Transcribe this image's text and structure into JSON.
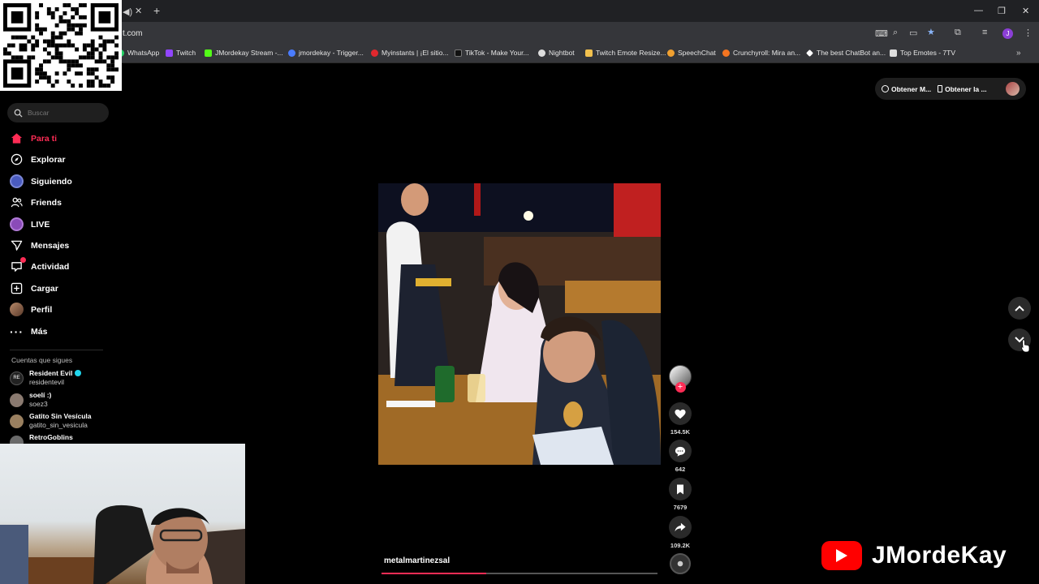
{
  "browser": {
    "url_fragment": "t.com",
    "bookmarks": [
      {
        "label": "WhatsApp",
        "color": "#25d366"
      },
      {
        "label": "Twitch",
        "color": "#9146ff"
      },
      {
        "label": "JMordekay Stream -...",
        "color": "#53fc18"
      },
      {
        "label": "jmordekay - Trigger...",
        "color": "#4a7cff"
      },
      {
        "label": "Myinstants | ¡El sitio...",
        "color": "#e0282e"
      },
      {
        "label": "TikTok - Make Your...",
        "color": "#111111"
      },
      {
        "label": "Nightbot",
        "color": "#dddddd"
      },
      {
        "label": "Twitch Emote Resize...",
        "color": "#f2c14e"
      },
      {
        "label": "SpeechChat",
        "color": "#f0a030"
      },
      {
        "label": "Crunchyroll: Mira an...",
        "color": "#f47521"
      },
      {
        "label": "The best ChatBot an...",
        "color": "#ffffff"
      },
      {
        "label": "Top Emotes - 7TV",
        "color": "#dddddd"
      }
    ]
  },
  "search": {
    "placeholder": "Buscar"
  },
  "nav": [
    {
      "label": "Para ti",
      "icon": "home-icon"
    },
    {
      "label": "Explorar",
      "icon": "compass-icon"
    },
    {
      "label": "Siguiendo",
      "icon": "following-avatar-icon"
    },
    {
      "label": "Friends",
      "icon": "friends-icon"
    },
    {
      "label": "LIVE",
      "icon": "live-icon"
    },
    {
      "label": "Mensajes",
      "icon": "send-icon"
    },
    {
      "label": "Actividad",
      "icon": "activity-icon"
    },
    {
      "label": "Cargar",
      "icon": "upload-icon"
    },
    {
      "label": "Perfil",
      "icon": "profile-avatar-icon"
    },
    {
      "label": "Más",
      "icon": "more-icon"
    }
  ],
  "following": {
    "title": "Cuentas que sigues",
    "accounts": [
      {
        "name": "Resident Evil",
        "username": "residentevil",
        "verified": true
      },
      {
        "name": "soelí :)",
        "username": "soez3"
      },
      {
        "name": "Gatito Sin Vesícula",
        "username": "gatito_sin_vesicula"
      },
      {
        "name": "RetroGoblins",
        "username": ""
      }
    ]
  },
  "topbar": {
    "get_app_label": "Obtener M...",
    "get_desktop_label": "Obtener la ..."
  },
  "video": {
    "author": "metalmartinezsal",
    "likes": "154.5K",
    "comments": "642",
    "saves": "7679",
    "shares": "109.2K",
    "progress": 0.38
  },
  "watermark": {
    "channel": "JMordeKay"
  },
  "colors": {
    "accent": "#fe2c55",
    "youtube": "#ff0000"
  }
}
